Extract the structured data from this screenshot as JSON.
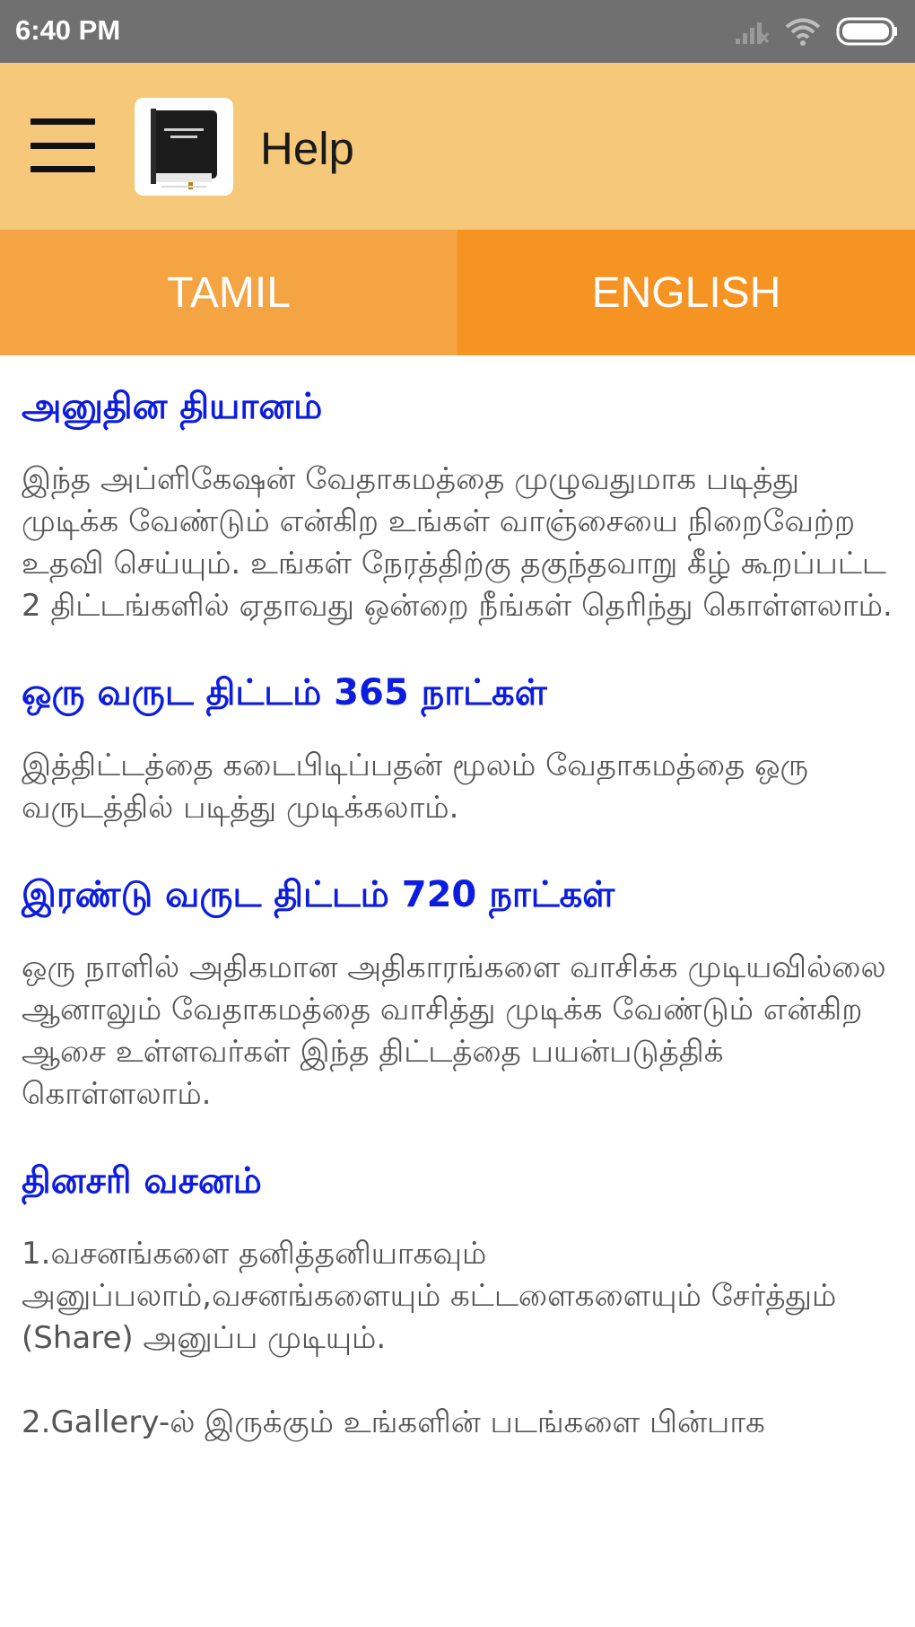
{
  "status_bar": {
    "time": "6:40 PM",
    "icons": [
      "signal-icon",
      "wifi-icon",
      "battery-icon"
    ]
  },
  "app_bar": {
    "title": "Help",
    "menu_icon": "hamburger-menu-icon",
    "logo": "bible-book-logo",
    "color": "#f5c87a"
  },
  "tabs": [
    {
      "label": "TAMIL",
      "selected": true,
      "color": "#f5a444"
    },
    {
      "label": "ENGLISH",
      "selected": false,
      "color": "#f59422"
    }
  ],
  "sections": [
    {
      "title": "அனுதின தியானம்",
      "body": "இந்த அப்ளிகேஷன் வேதாகமத்தை முழுவதுமாக படித்து முடிக்க வேண்டும் என்கிற உங்கள் வாஞ்சையை நிறைவேற்ற உதவி செய்யும். உங்கள் நேரத்திற்கு தகுந்தவாறு கீழ் கூறப்பட்ட 2 திட்டங்களில் ஏதாவது ஒன்றை நீங்கள் தெரிந்து கொள்ளலாம்."
    },
    {
      "title": "ஒரு வருட திட்டம் 365 நாட்கள்",
      "body": "இத்திட்டத்தை கடைபிடிப்பதன் மூலம் வேதாகமத்தை ஒரு வருடத்தில் படித்து முடிக்கலாம்."
    },
    {
      "title": "இரண்டு வருட திட்டம் 720 நாட்கள்",
      "body": "ஒரு நாளில் அதிகமான அதிகாரங்களை வாசிக்க முடியவில்லை ஆனாலும் வேதாகமத்தை வாசித்து முடிக்க வேண்டும் என்கிற ஆசை உள்ளவர்கள் இந்த திட்டத்தை பயன்படுத்திக் கொள்ளலாம்."
    },
    {
      "title": "தினசரி வசனம்",
      "body": "1.வசனங்களை தனித்தனியாகவும் அனுப்பலாம்,வசனங்களையும் கட்டளைகளையும் சேர்த்தும் (Share) அனுப்ப முடியும்.",
      "body2": "2.Gallery-ல் இருக்கும் உங்களின் படங்களை பின்பாக"
    }
  ],
  "colors": {
    "heading": "#0d1de0",
    "body_text": "#555555"
  }
}
